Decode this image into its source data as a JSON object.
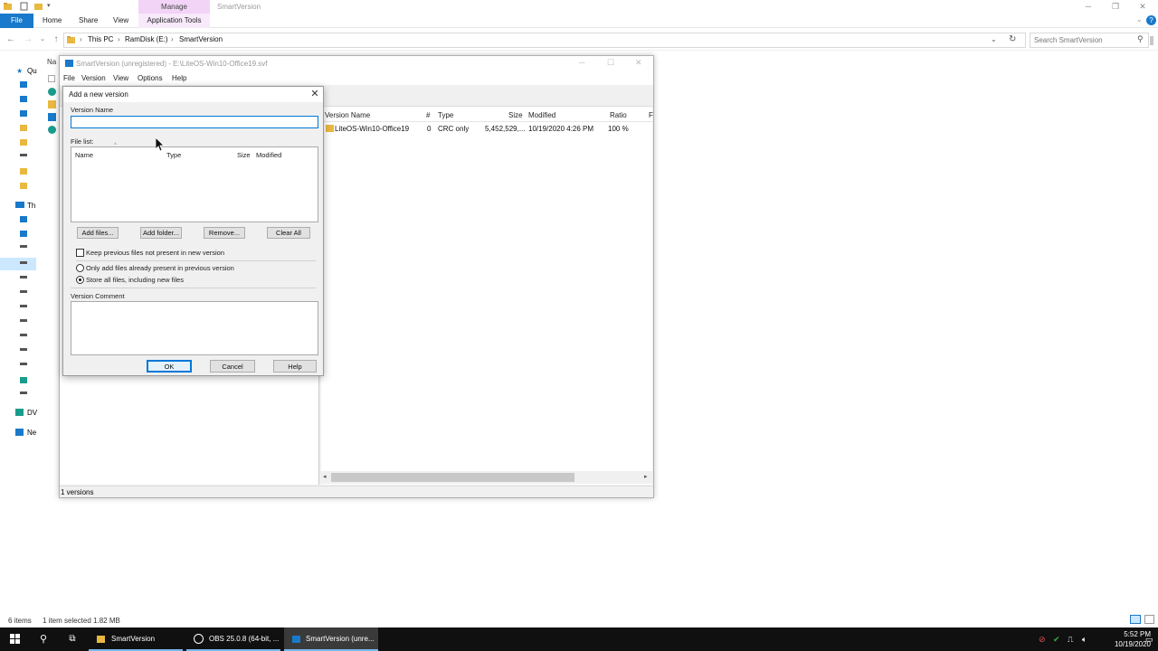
{
  "explorer": {
    "title": "SmartVersion",
    "manage_tab": "Manage",
    "ribbon": {
      "file": "File",
      "home": "Home",
      "share": "Share",
      "view": "View",
      "app_tools": "Application Tools"
    },
    "breadcrumb": [
      "This PC",
      "RamDisk (E:)",
      "SmartVersion"
    ],
    "search_placeholder": "Search SmartVersion",
    "nav_pane": {
      "quick_access": "Qu",
      "this_pc": "Th",
      "dvd": "DV",
      "network": "Ne",
      "name_col": "Na"
    },
    "status": {
      "items": "6 items",
      "selected": "1 item selected  1.82 MB"
    }
  },
  "smartversion": {
    "title": "SmartVersion (unregistered) - E:\\LiteOS-Win10-Office19.svf",
    "menu": [
      "File",
      "Version",
      "View",
      "Options",
      "Help"
    ],
    "columns": {
      "version_name": "Version Name",
      "num": "#",
      "type": "Type",
      "size": "Size",
      "modified": "Modified",
      "ratio": "Ratio",
      "extra": "F"
    },
    "rows": [
      {
        "version_name": "LiteOS-Win10-Office19",
        "num": "0",
        "type": "CRC only",
        "size": "5,452,529,...",
        "modified": "10/19/2020 4:26 PM",
        "ratio": "100 %"
      }
    ],
    "status": "1 versions"
  },
  "dialog": {
    "title": "Add a new version",
    "version_name_label": "Version Name",
    "version_name_value": "",
    "file_list_label": "File list:",
    "file_list_columns": {
      "name": "Name",
      "type": "Type",
      "size": "Size",
      "modified": "Modified"
    },
    "buttons": {
      "add_files": "Add files...",
      "add_folder": "Add folder...",
      "remove": "Remove...",
      "clear_all": "Clear All",
      "ok": "OK",
      "cancel": "Cancel",
      "help": "Help"
    },
    "keep_previous_label": "Keep previous files not present in new version",
    "keep_previous_checked": false,
    "only_add_label": "Only add files already present in previous version",
    "store_all_label": "Store all files, including new files",
    "selected_option": "store_all",
    "version_comment_label": "Version Comment",
    "version_comment_value": ""
  },
  "taskbar": {
    "items": [
      {
        "label": "SmartVersion",
        "icon": "folder-icon"
      },
      {
        "label": "OBS 25.0.8 (64-bit, ...",
        "icon": "obs-icon"
      },
      {
        "label": "SmartVersion (unre...",
        "icon": "smartversion-icon"
      }
    ],
    "time": "5:52 PM",
    "date": "10/19/2020"
  },
  "colors": {
    "accent": "#0078d7",
    "file_tab": "#1979ca",
    "manage_tab": "#f2d4f7",
    "taskbar": "#101010"
  }
}
